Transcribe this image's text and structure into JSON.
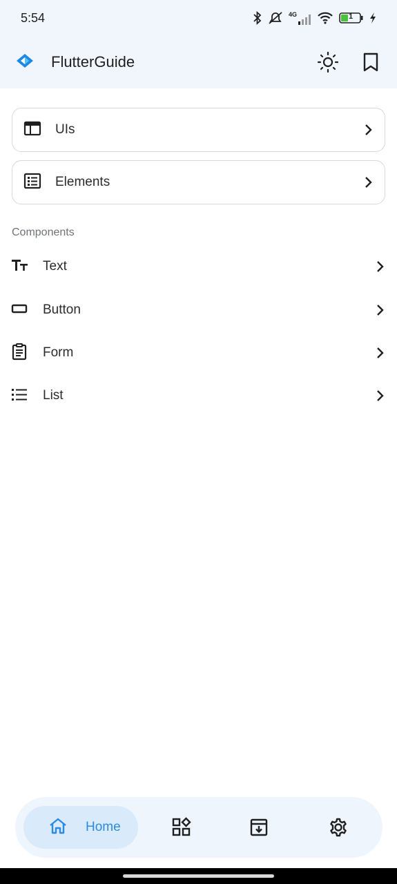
{
  "status_bar": {
    "time": "5:54",
    "network": "4G",
    "battery": "1",
    "icons": [
      "bluetooth-icon",
      "muted-notification-icon",
      "signal-icon",
      "wifi-icon",
      "battery-icon",
      "charging-icon"
    ]
  },
  "app_bar": {
    "title": "FlutterGuide",
    "actions": [
      "theme-toggle-icon",
      "bookmark-icon"
    ]
  },
  "cards": [
    {
      "label": "UIs",
      "icon": "web-layout-icon"
    },
    {
      "label": "Elements",
      "icon": "list-box-icon"
    }
  ],
  "section": {
    "title": "Components"
  },
  "components": [
    {
      "label": "Text",
      "icon": "text-fields-icon"
    },
    {
      "label": "Button",
      "icon": "button-icon"
    },
    {
      "label": "Form",
      "icon": "clipboard-icon"
    },
    {
      "label": "List",
      "icon": "list-icon"
    }
  ],
  "bottom_nav": {
    "home_label": "Home",
    "items": [
      "home-icon",
      "widgets-icon",
      "archive-icon",
      "settings-icon"
    ],
    "active": "Home",
    "accent_color": "#2a8be0"
  }
}
